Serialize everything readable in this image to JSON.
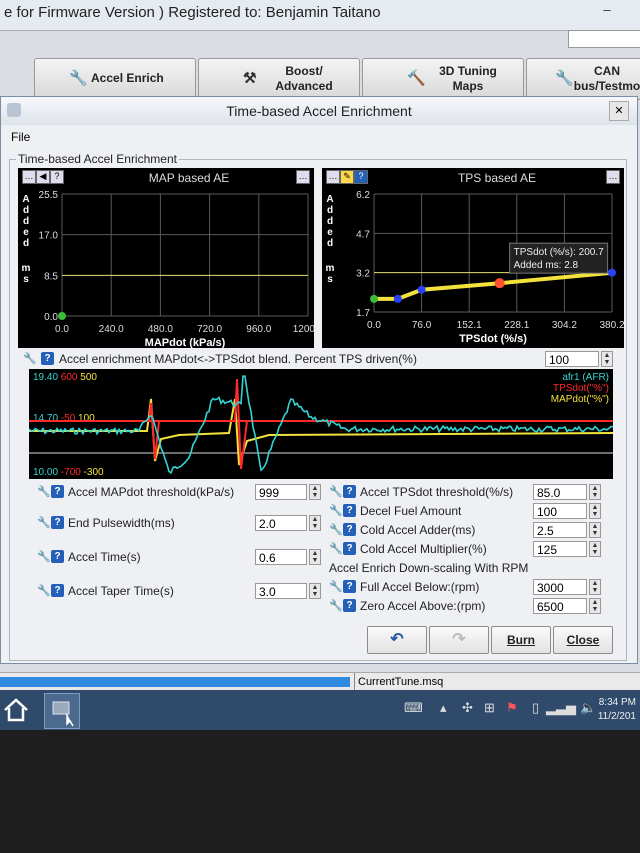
{
  "window": {
    "title": "e for Firmware Version ) Registered to: Benjamin Taitano"
  },
  "tabs": [
    {
      "label": "Accel Enrich",
      "icon": "wrench-icon"
    },
    {
      "label": "Boost/\nAdvanced",
      "line1": "Boost/",
      "line2": "Advanced",
      "icon": "tools-icon"
    },
    {
      "label": "3D Tuning Maps",
      "line1": "3D Tuning",
      "line2": "Maps",
      "icon": "hammer-icon"
    },
    {
      "label": "CAN bus/Testmo",
      "line1": "CAN",
      "line2": "bus/Testmo",
      "icon": "wrench-icon"
    }
  ],
  "dialog": {
    "title": "Time-based Accel Enrichment",
    "menu_file": "File",
    "group_label": "Time-based Accel Enrichment",
    "blend_label": "Accel enrichment MAPdot<->TPSdot blend. Percent TPS driven(%)",
    "blend_value": "100",
    "buttons": {
      "burn": "Burn",
      "close": "Close"
    }
  },
  "map_chart": {
    "title": "MAP based AE",
    "ylabel": "Added ms",
    "y_ticks": [
      "25.5",
      "17.0",
      "8.5",
      "0.0"
    ],
    "x_ticks": [
      "0.0",
      "240.0",
      "480.0",
      "720.0",
      "960.0",
      "1200.0"
    ],
    "xlabel": "MAPdot (kPa/s)"
  },
  "tps_chart": {
    "title": "TPS based AE",
    "ylabel": "Added ms",
    "y_ticks": [
      "6.2",
      "4.7",
      "3.2",
      "1.7"
    ],
    "x_ticks": [
      "0.0",
      "76.0",
      "152.1",
      "228.1",
      "304.2",
      "380.2"
    ],
    "xlabel": "TPSdot (%/s)",
    "tooltip_line1": "TPSdot (%/s): 200.7",
    "tooltip_line2": "Added ms: 2.8"
  },
  "chart_data": [
    {
      "type": "line",
      "title": "MAP based AE",
      "xlabel": "MAPdot (kPa/s)",
      "ylabel": "Added ms",
      "xlim": [
        0,
        1200
      ],
      "ylim": [
        0,
        25.5
      ],
      "series": [
        {
          "values": [
            [
              0.0,
              0.0
            ]
          ]
        }
      ]
    },
    {
      "type": "line",
      "title": "TPS based AE",
      "xlabel": "TPSdot (%/s)",
      "ylabel": "Added ms",
      "xlim": [
        0,
        380.2
      ],
      "ylim": [
        1.7,
        6.2
      ],
      "series": [
        {
          "values": [
            [
              0.0,
              2.2
            ],
            [
              38.0,
              2.2
            ],
            [
              76.0,
              2.55
            ],
            [
              200.7,
              2.8
            ],
            [
              380.2,
              3.2
            ]
          ]
        }
      ]
    }
  ],
  "trace_chart": {
    "left_top": [
      "19.40",
      "600",
      "500"
    ],
    "left_mid": [
      "14.70",
      "-50",
      "100"
    ],
    "left_bottom": [
      "10.00",
      "-700",
      "-300"
    ],
    "legend": [
      "afr1 (AFR)",
      "TPSdot(\"%\")",
      "MAPdot(\"%\")"
    ],
    "colors": {
      "afr": "#32d4d4",
      "tps": "#ff2a2a",
      "map": "#f2e23c"
    }
  },
  "params_left": [
    {
      "label": "Accel MAPdot threshold(kPa/s)",
      "value": "999"
    },
    {
      "label": "End Pulsewidth(ms)",
      "value": "2.0"
    },
    {
      "label": "Accel Time(s)",
      "value": "0.6"
    },
    {
      "label": "Accel Taper Time(s)",
      "value": "3.0"
    }
  ],
  "params_right": [
    {
      "label": "Accel TPSdot threshold(%/s)",
      "value": "85.0"
    },
    {
      "label": "Decel Fuel Amount",
      "value": "100"
    },
    {
      "label": "Cold Accel Adder(ms)",
      "value": "2.5"
    },
    {
      "label": "Cold Accel Multiplier(%)",
      "value": "125"
    }
  ],
  "downscale": {
    "title": "Accel Enrich Down-scaling With RPM",
    "items": [
      {
        "label": "Full Accel Below:(rpm)",
        "value": "3000"
      },
      {
        "label": "Zero Accel Above:(rpm)",
        "value": "6500"
      }
    ]
  },
  "statusbar": {
    "file": "CurrentTune.msq"
  },
  "clock": {
    "time": "8:34 PM",
    "date": "11/2/201"
  },
  "sidebar_fragment": "MA"
}
